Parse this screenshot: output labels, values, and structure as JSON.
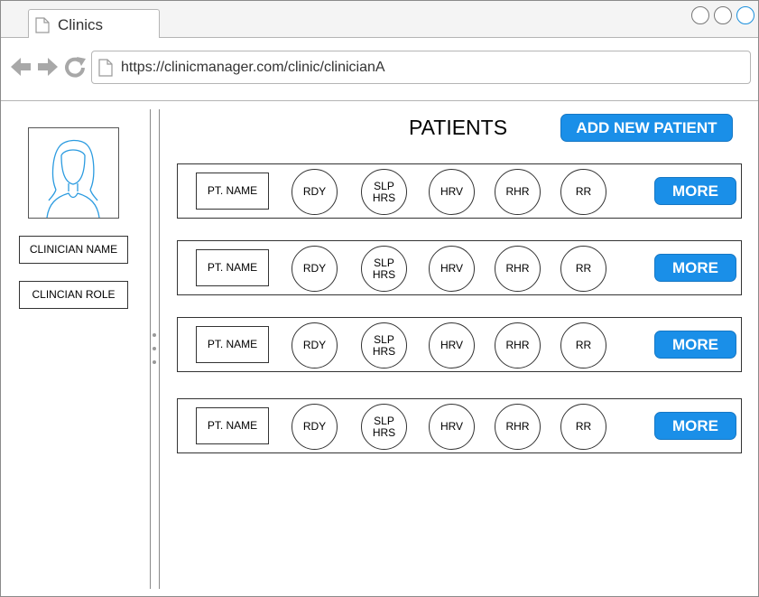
{
  "browser": {
    "tab_title": "Clinics",
    "url": "https://clinicmanager.com/clinic/clinicianA"
  },
  "sidebar": {
    "clinician_name": "CLINICIAN NAME",
    "clinician_role": "CLINCIAN ROLE"
  },
  "main": {
    "title": "PATIENTS",
    "add_button": "ADD NEW PATIENT",
    "patients": [
      {
        "name": "PT. NAME",
        "rdy": "RDY",
        "slp": "SLP\nHRS",
        "hrv": "HRV",
        "rhr": "RHR",
        "rr": "RR",
        "more": "MORE"
      },
      {
        "name": "PT. NAME",
        "rdy": "RDY",
        "slp": "SLP\nHRS",
        "hrv": "HRV",
        "rhr": "RHR",
        "rr": "RR",
        "more": "MORE"
      },
      {
        "name": "PT. NAME",
        "rdy": "RDY",
        "slp": "SLP\nHRS",
        "hrv": "HRV",
        "rhr": "RHR",
        "rr": "RR",
        "more": "MORE"
      },
      {
        "name": "PT. NAME",
        "rdy": "RDY",
        "slp": "SLP\nHRS",
        "hrv": "HRV",
        "rhr": "RHR",
        "rr": "RR",
        "more": "MORE"
      }
    ]
  },
  "colors": {
    "accent": "#1a8fe8",
    "avatar_stroke": "#2b9be0"
  },
  "icons": [
    "document-icon",
    "back-arrow-icon",
    "forward-arrow-icon",
    "reload-icon",
    "avatar-icon"
  ]
}
